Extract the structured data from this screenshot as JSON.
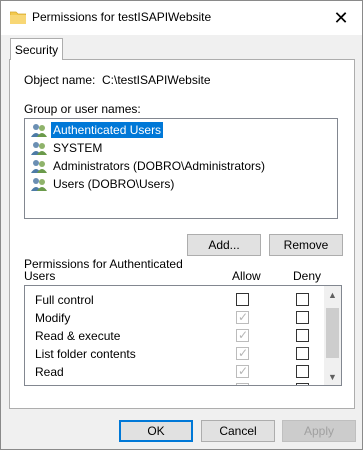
{
  "window": {
    "title": "Permissions for testISAPIWebsite",
    "close_glyph": "✕"
  },
  "tabs": [
    {
      "label": "Security"
    }
  ],
  "object": {
    "label": "Object name:",
    "value": "C:\\testISAPIWebsite"
  },
  "groups": {
    "label": "Group or user names:",
    "items": [
      {
        "label": "Authenticated Users",
        "selected": true
      },
      {
        "label": "SYSTEM",
        "selected": false
      },
      {
        "label": "Administrators (DOBRO\\Administrators)",
        "selected": false
      },
      {
        "label": "Users (DOBRO\\Users)",
        "selected": false
      }
    ],
    "add_label": "Add...",
    "remove_label": "Remove"
  },
  "permissions": {
    "header_line1": "Permissions for Authenticated",
    "header_line2": "Users",
    "allow_label": "Allow",
    "deny_label": "Deny",
    "rows": [
      {
        "name": "Full control",
        "allow": false,
        "allow_disabled": false,
        "deny": false
      },
      {
        "name": "Modify",
        "allow": true,
        "allow_disabled": true,
        "deny": false
      },
      {
        "name": "Read & execute",
        "allow": true,
        "allow_disabled": true,
        "deny": false
      },
      {
        "name": "List folder contents",
        "allow": true,
        "allow_disabled": true,
        "deny": false
      },
      {
        "name": "Read",
        "allow": true,
        "allow_disabled": true,
        "deny": false
      }
    ]
  },
  "footer": {
    "ok_label": "OK",
    "cancel_label": "Cancel",
    "apply_label": "Apply"
  },
  "colors": {
    "selection": "#0078d7",
    "folder": "#f3c94f"
  }
}
